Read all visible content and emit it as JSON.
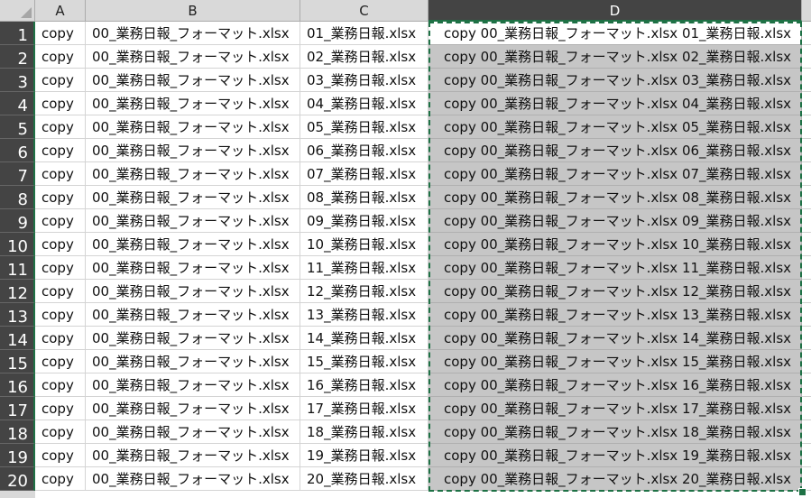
{
  "columns": [
    "A",
    "B",
    "C",
    "D"
  ],
  "rows": [
    {
      "n": "1",
      "a": "copy",
      "b": "00_業務日報_フォーマット.xlsx",
      "c": "01_業務日報.xlsx",
      "d": "copy 00_業務日報_フォーマット.xlsx 01_業務日報.xlsx"
    },
    {
      "n": "2",
      "a": "copy",
      "b": "00_業務日報_フォーマット.xlsx",
      "c": "02_業務日報.xlsx",
      "d": "copy 00_業務日報_フォーマット.xlsx 02_業務日報.xlsx"
    },
    {
      "n": "3",
      "a": "copy",
      "b": "00_業務日報_フォーマット.xlsx",
      "c": "03_業務日報.xlsx",
      "d": "copy 00_業務日報_フォーマット.xlsx 03_業務日報.xlsx"
    },
    {
      "n": "4",
      "a": "copy",
      "b": "00_業務日報_フォーマット.xlsx",
      "c": "04_業務日報.xlsx",
      "d": "copy 00_業務日報_フォーマット.xlsx 04_業務日報.xlsx"
    },
    {
      "n": "5",
      "a": "copy",
      "b": "00_業務日報_フォーマット.xlsx",
      "c": "05_業務日報.xlsx",
      "d": "copy 00_業務日報_フォーマット.xlsx 05_業務日報.xlsx"
    },
    {
      "n": "6",
      "a": "copy",
      "b": "00_業務日報_フォーマット.xlsx",
      "c": "06_業務日報.xlsx",
      "d": "copy 00_業務日報_フォーマット.xlsx 06_業務日報.xlsx"
    },
    {
      "n": "7",
      "a": "copy",
      "b": "00_業務日報_フォーマット.xlsx",
      "c": "07_業務日報.xlsx",
      "d": "copy 00_業務日報_フォーマット.xlsx 07_業務日報.xlsx"
    },
    {
      "n": "8",
      "a": "copy",
      "b": "00_業務日報_フォーマット.xlsx",
      "c": "08_業務日報.xlsx",
      "d": "copy 00_業務日報_フォーマット.xlsx 08_業務日報.xlsx"
    },
    {
      "n": "9",
      "a": "copy",
      "b": "00_業務日報_フォーマット.xlsx",
      "c": "09_業務日報.xlsx",
      "d": "copy 00_業務日報_フォーマット.xlsx 09_業務日報.xlsx"
    },
    {
      "n": "10",
      "a": "copy",
      "b": "00_業務日報_フォーマット.xlsx",
      "c": "10_業務日報.xlsx",
      "d": "copy 00_業務日報_フォーマット.xlsx 10_業務日報.xlsx"
    },
    {
      "n": "11",
      "a": "copy",
      "b": "00_業務日報_フォーマット.xlsx",
      "c": "11_業務日報.xlsx",
      "d": "copy 00_業務日報_フォーマット.xlsx 11_業務日報.xlsx"
    },
    {
      "n": "12",
      "a": "copy",
      "b": "00_業務日報_フォーマット.xlsx",
      "c": "12_業務日報.xlsx",
      "d": "copy 00_業務日報_フォーマット.xlsx 12_業務日報.xlsx"
    },
    {
      "n": "13",
      "a": "copy",
      "b": "00_業務日報_フォーマット.xlsx",
      "c": "13_業務日報.xlsx",
      "d": "copy 00_業務日報_フォーマット.xlsx 13_業務日報.xlsx"
    },
    {
      "n": "14",
      "a": "copy",
      "b": "00_業務日報_フォーマット.xlsx",
      "c": "14_業務日報.xlsx",
      "d": "copy 00_業務日報_フォーマット.xlsx 14_業務日報.xlsx"
    },
    {
      "n": "15",
      "a": "copy",
      "b": "00_業務日報_フォーマット.xlsx",
      "c": "15_業務日報.xlsx",
      "d": "copy 00_業務日報_フォーマット.xlsx 15_業務日報.xlsx"
    },
    {
      "n": "16",
      "a": "copy",
      "b": "00_業務日報_フォーマット.xlsx",
      "c": "16_業務日報.xlsx",
      "d": "copy 00_業務日報_フォーマット.xlsx 16_業務日報.xlsx"
    },
    {
      "n": "17",
      "a": "copy",
      "b": "00_業務日報_フォーマット.xlsx",
      "c": "17_業務日報.xlsx",
      "d": "copy 00_業務日報_フォーマット.xlsx 17_業務日報.xlsx"
    },
    {
      "n": "18",
      "a": "copy",
      "b": "00_業務日報_フォーマット.xlsx",
      "c": "18_業務日報.xlsx",
      "d": "copy 00_業務日報_フォーマット.xlsx 18_業務日報.xlsx"
    },
    {
      "n": "19",
      "a": "copy",
      "b": "00_業務日報_フォーマット.xlsx",
      "c": "19_業務日報.xlsx",
      "d": "copy 00_業務日報_フォーマット.xlsx 19_業務日報.xlsx"
    },
    {
      "n": "20",
      "a": "copy",
      "b": "00_業務日報_フォーマット.xlsx",
      "c": "20_業務日報.xlsx",
      "d": "copy 00_業務日報_フォーマット.xlsx 20_業務日報.xlsx"
    }
  ],
  "selected_column": "D",
  "colors": {
    "selection_border": "#1e7145",
    "header_selected": "#444444",
    "selected_fill": "#c6c6c6"
  }
}
